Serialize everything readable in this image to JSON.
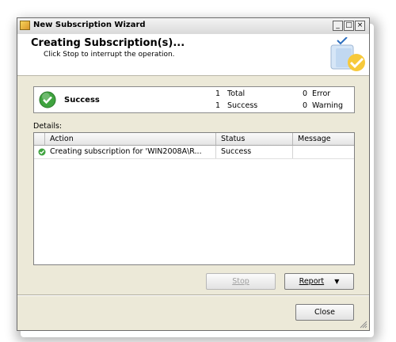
{
  "window": {
    "title": "New Subscription Wizard",
    "controls": {
      "minimize": "_",
      "maximize": "□",
      "close": "×"
    }
  },
  "header": {
    "title": "Creating Subscription(s)...",
    "subtitle": "Click Stop to interrupt the operation."
  },
  "status": {
    "result_label": "Success",
    "total_count": "1",
    "total_label": "Total",
    "success_count": "1",
    "success_label": "Success",
    "error_count": "0",
    "error_label": "Error",
    "warning_count": "0",
    "warning_label": "Warning"
  },
  "details": {
    "label": "Details:",
    "columns": [
      "Action",
      "Status",
      "Message"
    ],
    "rows": [
      {
        "action": "Creating subscription for 'WIN2008A\\R...",
        "status": "Success",
        "message": ""
      }
    ]
  },
  "buttons": {
    "stop": "Stop",
    "report": "Report",
    "close": "Close"
  },
  "colors": {
    "success_green": "#3fa33f",
    "dialog_bg": "#ece9d8"
  }
}
